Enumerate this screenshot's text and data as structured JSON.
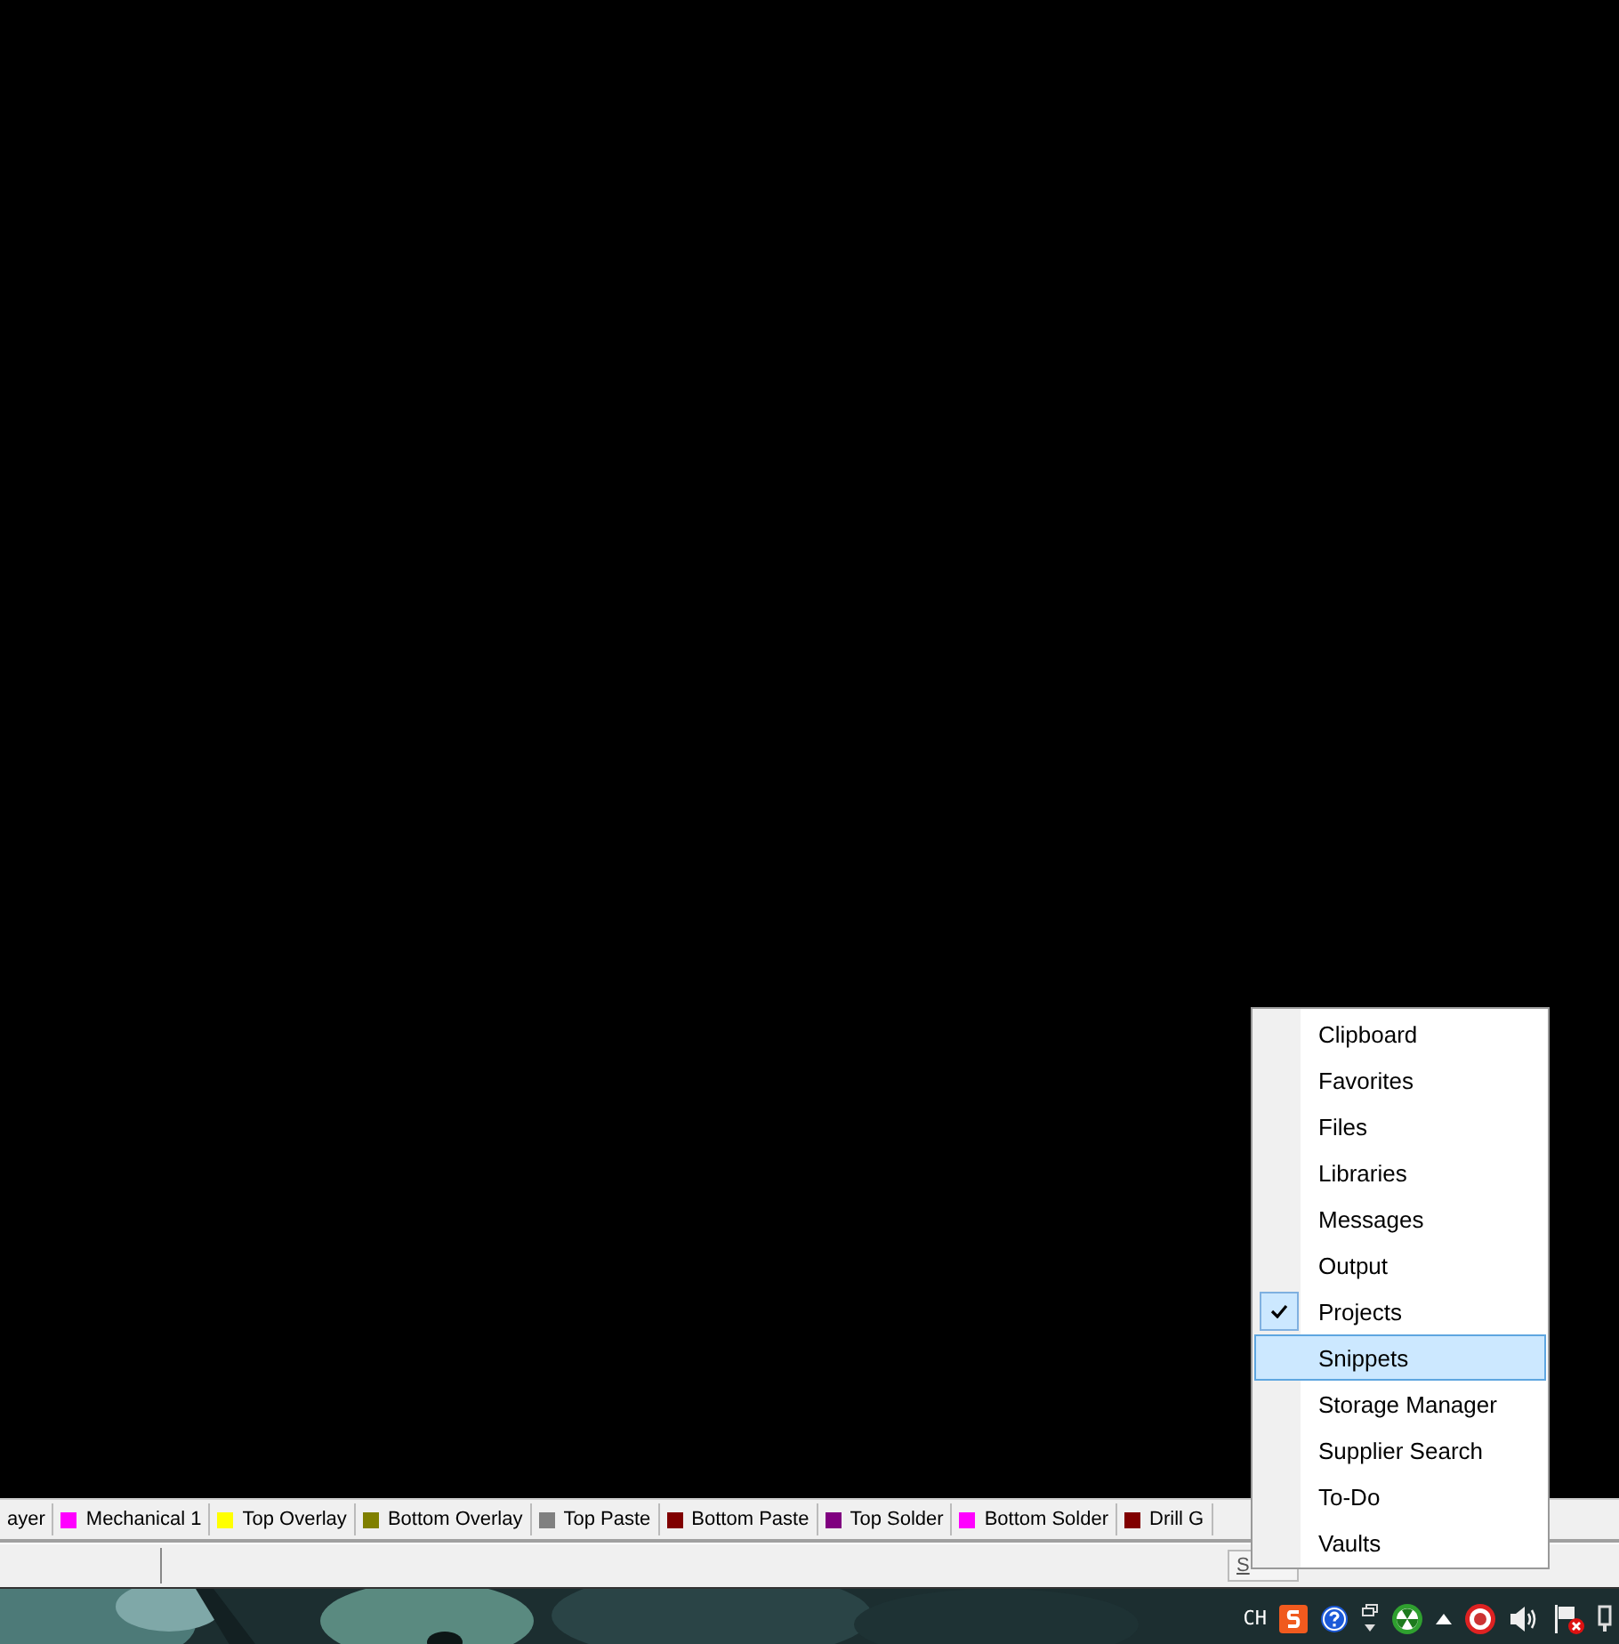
{
  "layer_tabs": [
    {
      "label": "ayer"
    },
    {
      "label": "Mechanical 1",
      "color": "#ff00ff"
    },
    {
      "label": "Top Overlay",
      "color": "#ffff00"
    },
    {
      "label": "Bottom Overlay",
      "color": "#808000"
    },
    {
      "label": "Top Paste",
      "color": "#808080"
    },
    {
      "label": "Bottom Paste",
      "color": "#800000"
    },
    {
      "label": "Top Solder",
      "color": "#800080"
    },
    {
      "label": "Bottom Solder",
      "color": "#ff00ff"
    },
    {
      "label": "Drill G",
      "color": "#800000"
    }
  ],
  "status_bar": {
    "buttons": [
      "S"
    ]
  },
  "context_menu": {
    "items": [
      {
        "label": "Clipboard",
        "checked": false,
        "selected": false
      },
      {
        "label": "Favorites",
        "checked": false,
        "selected": false
      },
      {
        "label": "Files",
        "checked": false,
        "selected": false
      },
      {
        "label": "Libraries",
        "checked": false,
        "selected": false
      },
      {
        "label": "Messages",
        "checked": false,
        "selected": false
      },
      {
        "label": "Output",
        "checked": false,
        "selected": false
      },
      {
        "label": "Projects",
        "checked": true,
        "selected": false
      },
      {
        "label": "Snippets",
        "checked": false,
        "selected": true
      },
      {
        "label": "Storage Manager",
        "checked": false,
        "selected": false
      },
      {
        "label": "Supplier Search",
        "checked": false,
        "selected": false
      },
      {
        "label": "To-Do",
        "checked": false,
        "selected": false
      },
      {
        "label": "Vaults",
        "checked": false,
        "selected": false
      }
    ]
  },
  "taskbar": {
    "language": "CH"
  }
}
